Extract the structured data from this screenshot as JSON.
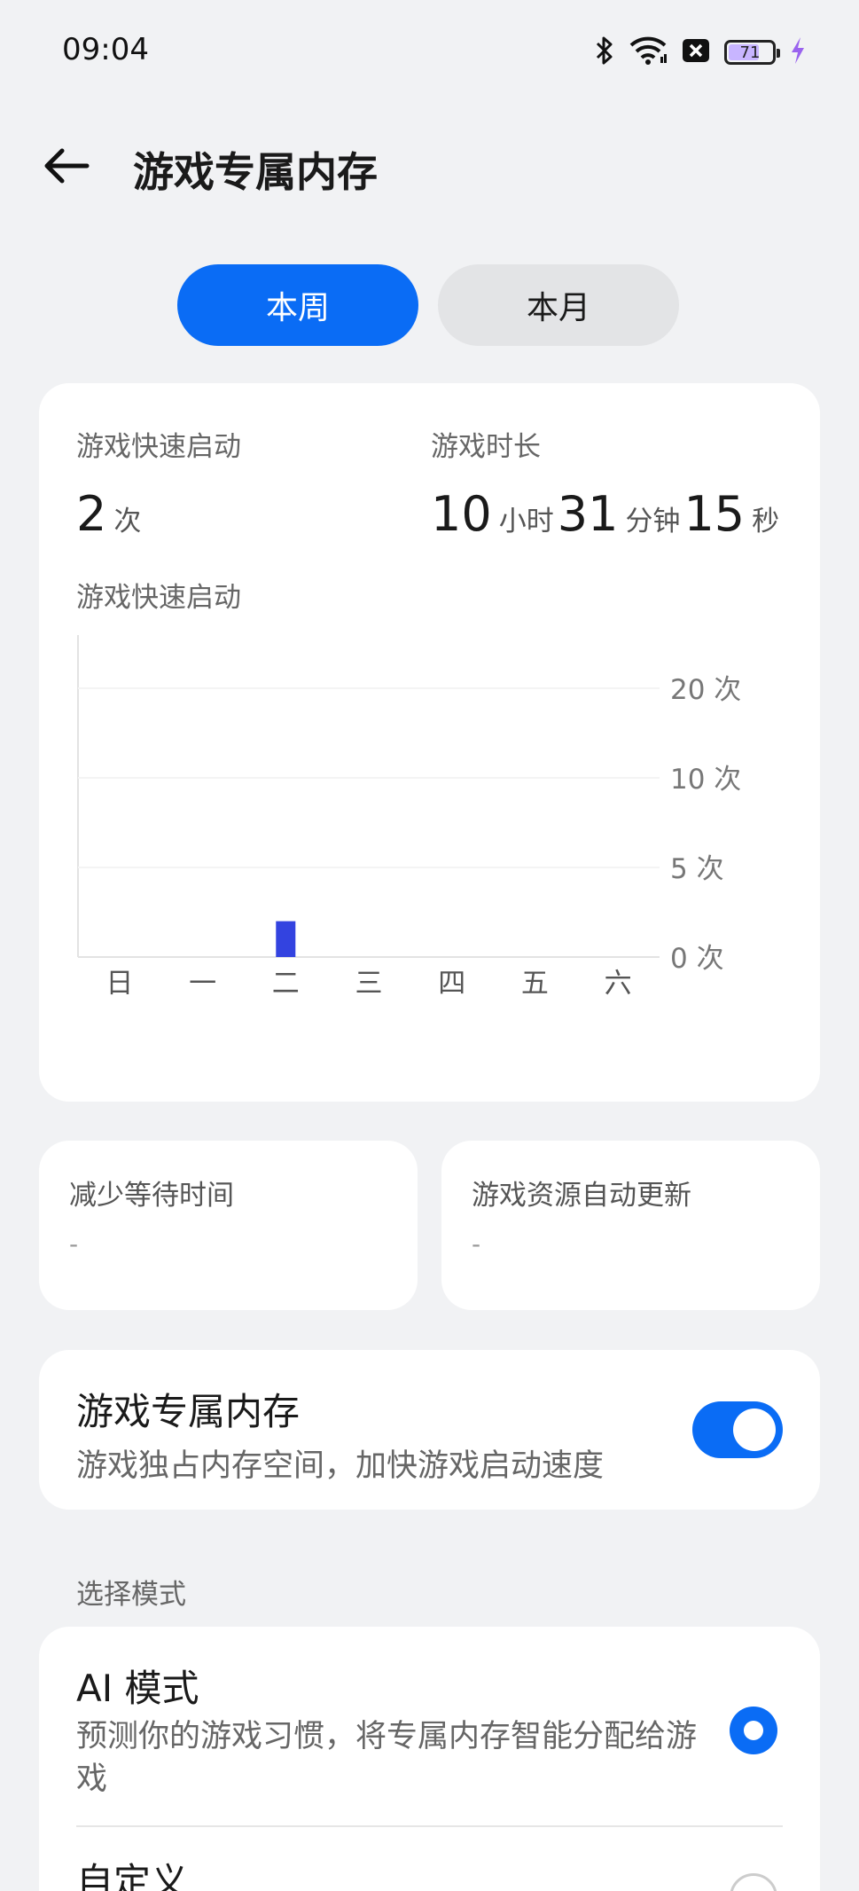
{
  "status_bar": {
    "time": "09:04",
    "icons": [
      "bluetooth-icon",
      "wifi-icon",
      "sim-off-icon",
      "battery-icon",
      "charging-icon"
    ],
    "battery_level": "71",
    "battery_fraction": 0.71
  },
  "header": {
    "title": "游戏专属内存"
  },
  "tabs": [
    {
      "label": "本周",
      "active": true
    },
    {
      "label": "本月",
      "active": false
    }
  ],
  "stats": {
    "quick_launch_label": "游戏快速启动",
    "quick_launch_count": "2",
    "quick_launch_unit": "次",
    "play_time_label": "游戏时长",
    "hours": "10",
    "hours_unit": "小时",
    "minutes": "31",
    "minutes_unit": "分钟",
    "seconds": "15",
    "seconds_unit": "秒"
  },
  "chart_data": {
    "type": "bar",
    "title": "游戏快速启动",
    "categories": [
      "日",
      "一",
      "二",
      "三",
      "四",
      "五",
      "六"
    ],
    "values": [
      0,
      0,
      2,
      0,
      0,
      0,
      0
    ],
    "y_ticks": [
      {
        "value": 0,
        "label": "0 次"
      },
      {
        "value": 5,
        "label": "5 次"
      },
      {
        "value": 10,
        "label": "10 次"
      },
      {
        "value": 20,
        "label": "20 次"
      }
    ],
    "bar_color": "#3343e0"
  },
  "summary_cards": [
    {
      "label": "减少等待时间",
      "value": "-"
    },
    {
      "label": "游戏资源自动更新",
      "value": "-"
    }
  ],
  "exclusive_memory": {
    "title": "游戏专属内存",
    "subtitle": "游戏独占内存空间，加快游戏启动速度",
    "enabled": true
  },
  "mode_section": {
    "label": "选择模式",
    "modes": [
      {
        "title": "AI 模式",
        "subtitle": "预测你的游戏习惯，将专属内存智能分配给游戏",
        "selected": true
      },
      {
        "title": "自定义",
        "selected": false
      }
    ]
  },
  "colors": {
    "accent": "#0a6cf5",
    "background": "#f1f2f4",
    "card": "#ffffff"
  }
}
